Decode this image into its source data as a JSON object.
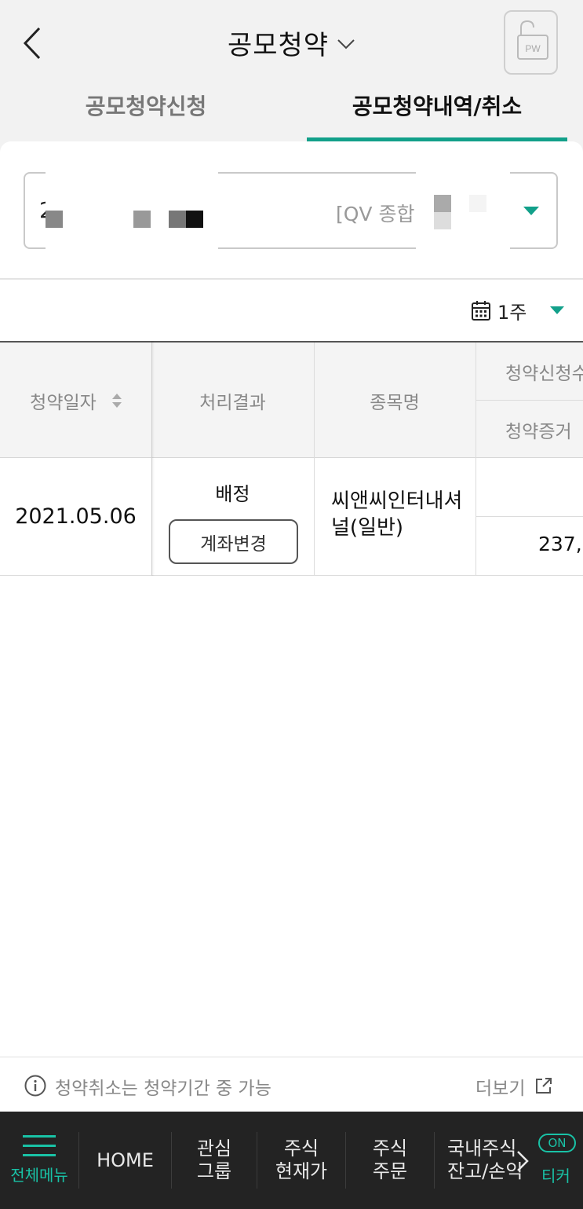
{
  "header": {
    "title": "공모청약",
    "pw_label": "PW"
  },
  "tabs": [
    {
      "label": "공모청약신청",
      "active": false
    },
    {
      "label": "공모청약내역/취소",
      "active": true
    }
  ],
  "account": {
    "number_prefix": "2",
    "type": "[QV 종합ㅁ"
  },
  "period": {
    "label": "1주"
  },
  "table": {
    "headers": {
      "date": "청약일자",
      "result": "처리결과",
      "name": "종목명",
      "qty_top": "청약신청수",
      "qty_bottom": "청약증거"
    },
    "rows": [
      {
        "date": "2021.05.06",
        "result": "배정",
        "change_label": "계좌변경",
        "name": "씨앤씨인터내셔널(일반)",
        "qty_top": "",
        "qty_bottom": "237,"
      }
    ]
  },
  "info": {
    "message": "청약취소는 청약기간 중 가능",
    "more": "더보기"
  },
  "bottom_nav": {
    "menu": "전체메뉴",
    "home": "HOME",
    "watch": [
      "관심",
      "그룹"
    ],
    "price": [
      "주식",
      "현재가"
    ],
    "order": [
      "주식",
      "주문"
    ],
    "balance": [
      "국내주식",
      "잔고/손익"
    ],
    "on": "ON",
    "ticker": "티커"
  },
  "colors": {
    "accent": "#12a08a",
    "nav_bg": "#232323",
    "nav_accent": "#19c2a6"
  }
}
